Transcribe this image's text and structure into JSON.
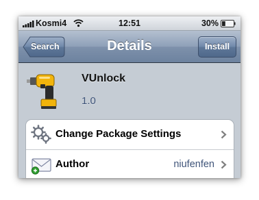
{
  "status_bar": {
    "carrier": "Kosmi4",
    "time": "12:51",
    "battery_percent": "30%",
    "battery_level": 0.3,
    "signal_bars": 5
  },
  "nav": {
    "back_label": "Search",
    "title": "Details",
    "action_label": "Install"
  },
  "package": {
    "name": "VUnlock",
    "version": "1.0",
    "icon": "power-drill-icon"
  },
  "rows": [
    {
      "label": "Change Package Settings",
      "value": "",
      "icon": "gears-icon"
    },
    {
      "label": "Author",
      "value": "niufenfen",
      "icon": "mail-envelope-icon"
    }
  ],
  "colors": {
    "nav_bar": "#7e91ab",
    "background": "#c5ccd4",
    "value_text": "#3f5479"
  }
}
